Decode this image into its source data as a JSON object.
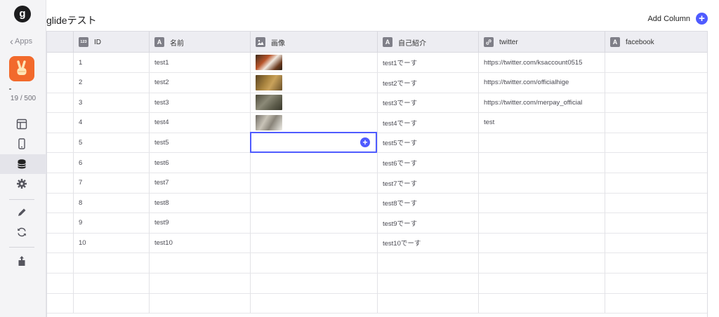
{
  "sidebar": {
    "logo": "g",
    "apps_label": "Apps",
    "row_count": "19 / 500",
    "app_icon": "victory-hand-emoji"
  },
  "header": {
    "title": "glideテスト",
    "add_column_label": "Add Column"
  },
  "table": {
    "columns": [
      {
        "name": "ID",
        "type": "number"
      },
      {
        "name": "名前",
        "type": "text"
      },
      {
        "name": "画像",
        "type": "image"
      },
      {
        "name": "自己紹介",
        "type": "text"
      },
      {
        "name": "twitter",
        "type": "link"
      },
      {
        "name": "facebook",
        "type": "text"
      }
    ],
    "rows": [
      {
        "id": "1",
        "name": "test1",
        "image": "red-panda",
        "intro": "test1でーす",
        "twitter": "https://twitter.com/ksaccount0515",
        "facebook": ""
      },
      {
        "id": "2",
        "name": "test2",
        "image": "lion",
        "intro": "test2でーす",
        "twitter": "https://twitter.com/officialhige",
        "facebook": ""
      },
      {
        "id": "3",
        "name": "test3",
        "image": "monkey",
        "intro": "test3でーす",
        "twitter": "https://twitter.com/merpay_official",
        "facebook": ""
      },
      {
        "id": "4",
        "name": "test4",
        "image": "cat",
        "intro": "test4でーす",
        "twitter": "test",
        "facebook": ""
      },
      {
        "id": "5",
        "name": "test5",
        "image": "",
        "intro": "test5でーす",
        "twitter": "",
        "facebook": ""
      },
      {
        "id": "6",
        "name": "test6",
        "image": "",
        "intro": "test6でーす",
        "twitter": "",
        "facebook": ""
      },
      {
        "id": "7",
        "name": "test7",
        "image": "",
        "intro": "test7でーす",
        "twitter": "",
        "facebook": ""
      },
      {
        "id": "8",
        "name": "test8",
        "image": "",
        "intro": "test8でーす",
        "twitter": "",
        "facebook": ""
      },
      {
        "id": "9",
        "name": "test9",
        "image": "",
        "intro": "test9でーす",
        "twitter": "",
        "facebook": ""
      },
      {
        "id": "10",
        "name": "test10",
        "image": "",
        "intro": "test10でーす",
        "twitter": "",
        "facebook": ""
      }
    ],
    "empty_rows": 3
  },
  "colors": {
    "accent": "#4f5bff",
    "app_tile": "#f26a2c"
  }
}
